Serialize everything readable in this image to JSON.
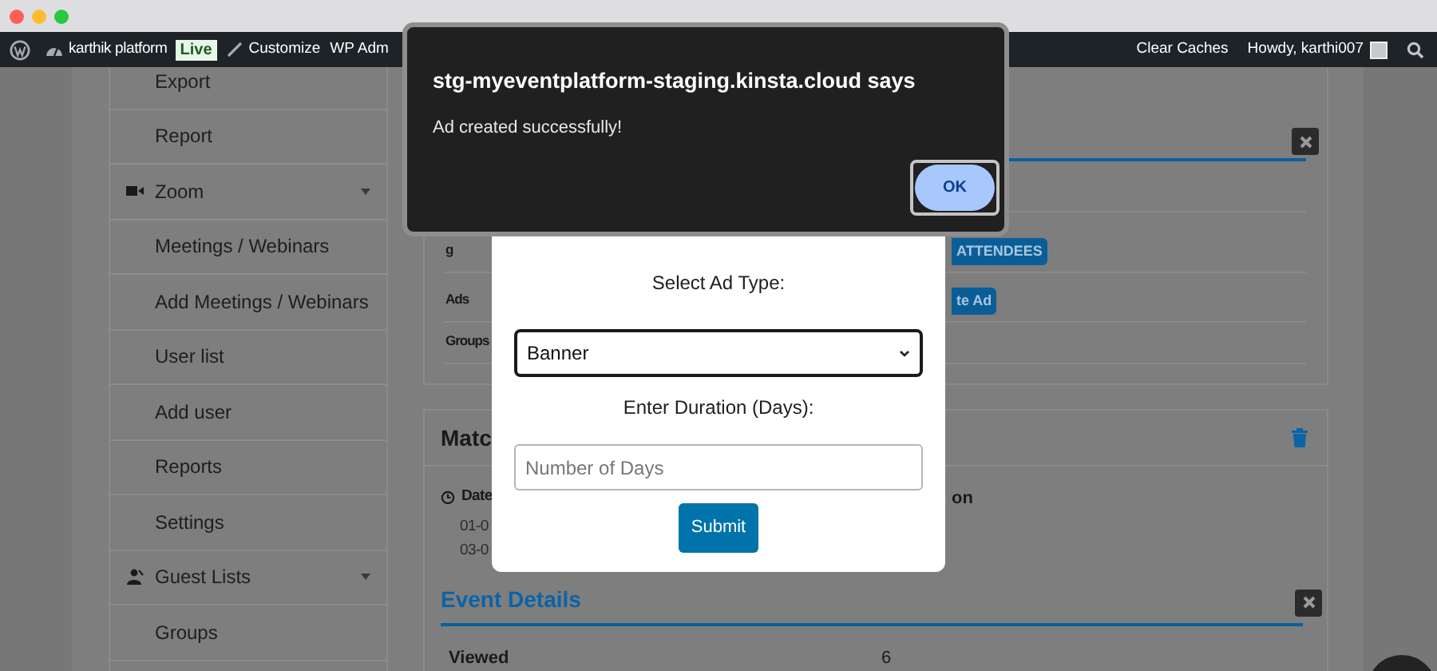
{
  "browser": {
    "traffic_lights": [
      {
        "color": "#ff5f57"
      },
      {
        "color": "#febc2e"
      },
      {
        "color": "#28c840"
      }
    ]
  },
  "admin_bar": {
    "site": "karthik platform",
    "badge": "Live",
    "customize": "Customize",
    "wp_admin": "WP Adm",
    "clear_caches": "Clear Caches",
    "greeting": "Howdy, karthi007"
  },
  "sidebar": {
    "items": [
      {
        "label": "Export",
        "kind": "sub"
      },
      {
        "label": "Report",
        "kind": "sub"
      },
      {
        "label": "Zoom",
        "kind": "group"
      },
      {
        "label": "Meetings / Webinars",
        "kind": "sub"
      },
      {
        "label": "Add Meetings / Webinars",
        "kind": "sub"
      },
      {
        "label": "User list",
        "kind": "sub"
      },
      {
        "label": "Add user",
        "kind": "sub"
      },
      {
        "label": "Reports",
        "kind": "sub"
      },
      {
        "label": "Settings",
        "kind": "sub"
      },
      {
        "label": "Guest Lists",
        "kind": "group"
      },
      {
        "label": "Groups",
        "kind": "sub"
      }
    ]
  },
  "settings_card": {
    "rows": [
      {
        "label": "g",
        "button": "ATTENDEES"
      },
      {
        "label": "Ads",
        "button": "te Ad"
      },
      {
        "label": "Groups"
      }
    ]
  },
  "match_card": {
    "title": "Matc",
    "date_label": "Date",
    "dates": [
      "01-0",
      "03-0"
    ],
    "column_2": "on"
  },
  "event_details": {
    "title": "Event Details",
    "rows": [
      {
        "label": "Viewed",
        "value": "6"
      }
    ]
  },
  "modal": {
    "ad_type_label": "Select Ad Type:",
    "ad_type": {
      "value": "Banner"
    },
    "duration_label": "Enter Duration (Days):",
    "duration": {
      "placeholder": "Number of Days"
    },
    "submit": "Submit"
  },
  "alert": {
    "title": "stg-myeventplatform-staging.kinsta.cloud says",
    "message": "Ad created successfully!",
    "ok": "OK"
  }
}
